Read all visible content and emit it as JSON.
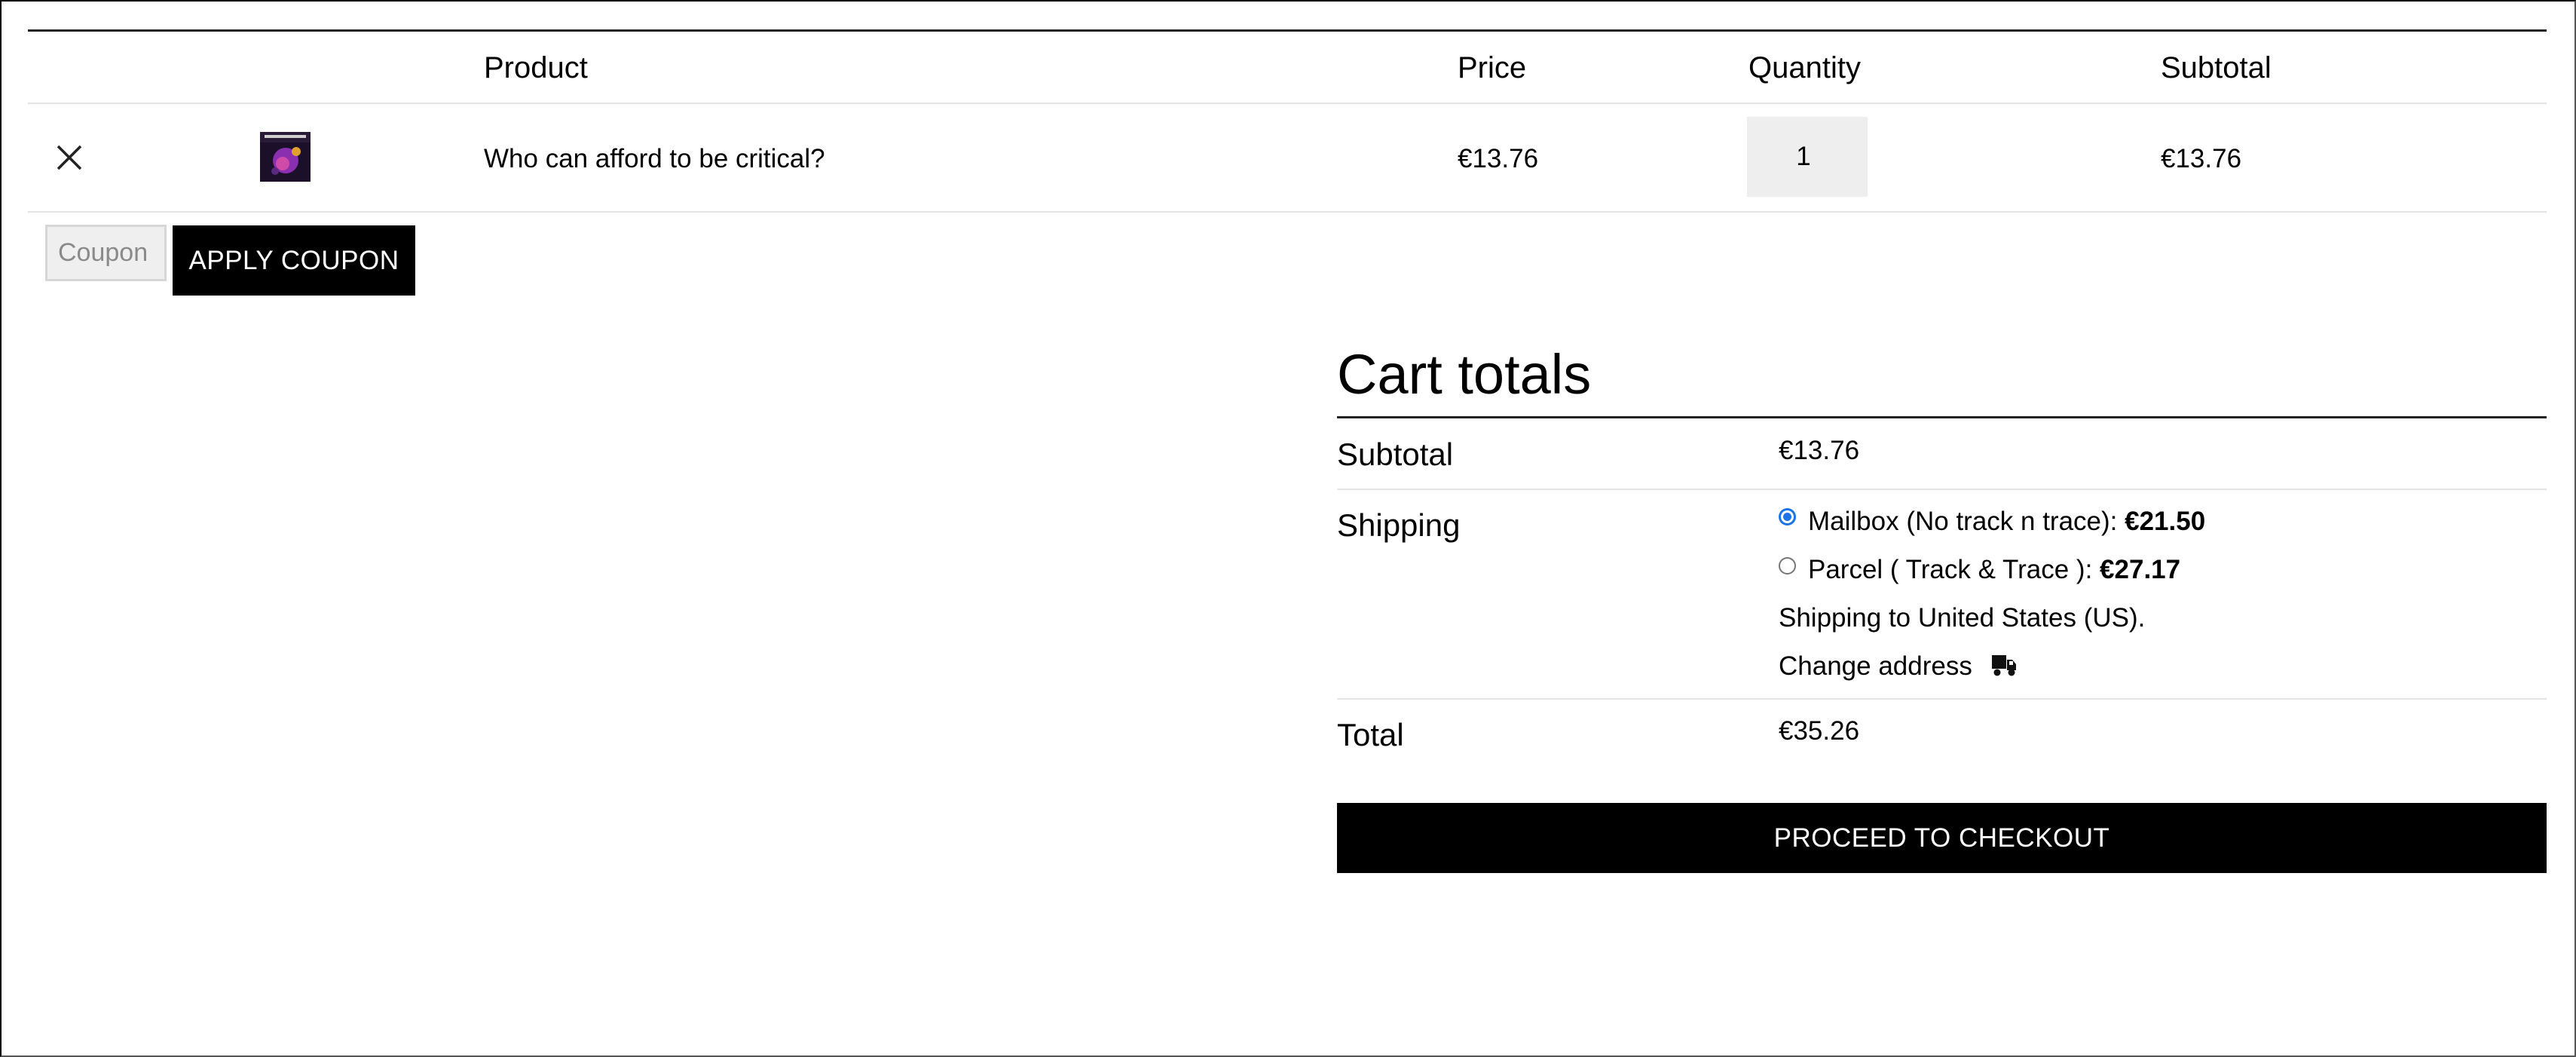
{
  "table": {
    "headers": {
      "product": "Product",
      "price": "Price",
      "quantity": "Quantity",
      "subtotal": "Subtotal"
    },
    "rows": [
      {
        "remove_icon": "close-icon",
        "thumbnail": "album-cover",
        "product": "Who can afford to be critical?",
        "price": "€13.76",
        "quantity": "1",
        "subtotal": "€13.76"
      }
    ]
  },
  "coupon": {
    "placeholder": "Coupon code",
    "display": "Coupon",
    "apply_label": "APPLY COUPON"
  },
  "cart_totals": {
    "title": "Cart totals",
    "subtotal_label": "Subtotal",
    "subtotal_value": "€13.76",
    "shipping_label": "Shipping",
    "shipping_options": [
      {
        "label": "Mailbox (No track n trace): ",
        "price": "€21.50",
        "selected": true
      },
      {
        "label": "Parcel ( Track & Trace ): ",
        "price": "€27.17",
        "selected": false
      }
    ],
    "shipping_destination": "Shipping to United States (US).",
    "change_address_label": "Change address",
    "change_address_icon": "truck-icon",
    "total_label": "Total",
    "total_value": "€35.26",
    "checkout_label": "PROCEED TO CHECKOUT"
  },
  "colors": {
    "accent": "#000000",
    "radio_selected": "#1a73e8",
    "input_bg": "#efefef",
    "quantity_bg": "#eeeeee"
  }
}
